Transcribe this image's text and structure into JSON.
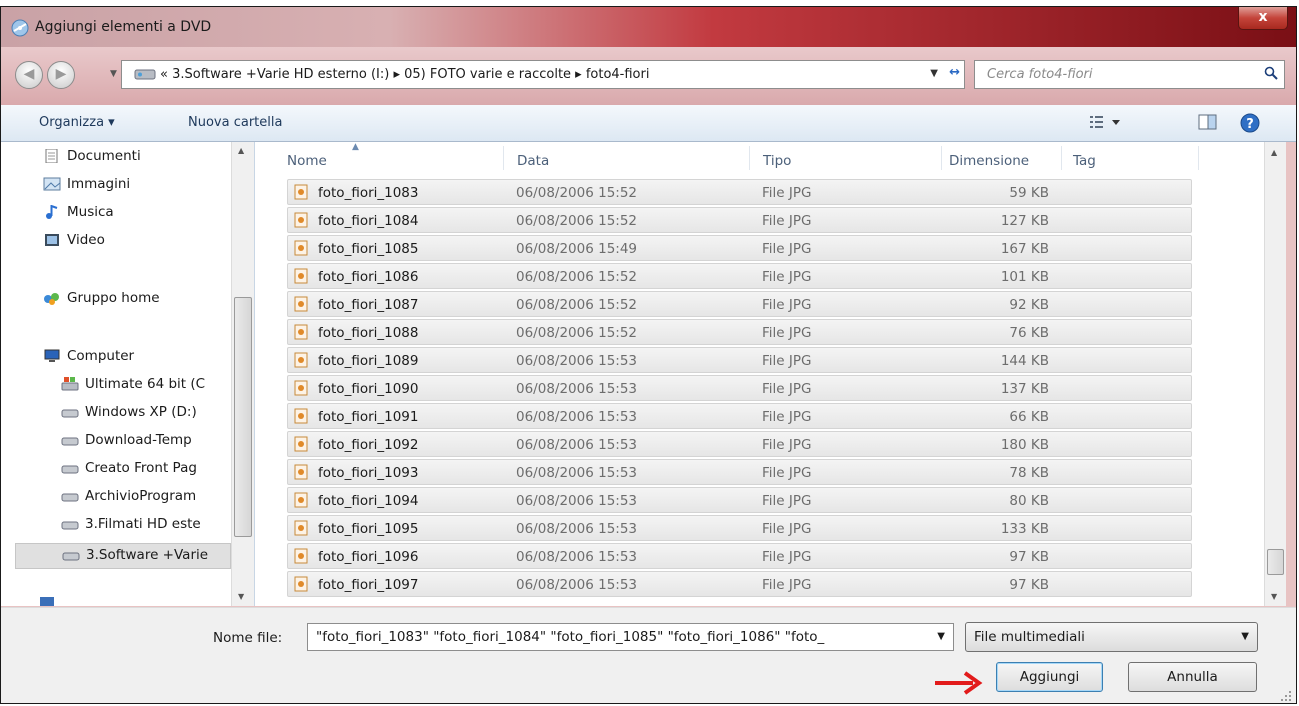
{
  "window": {
    "title": "Aggiungi elementi a DVD",
    "close_label": "x"
  },
  "address": {
    "breadcrumb": "« 3.Software +Varie HD esterno (I:) ▸ 05) FOTO varie e raccolte ▸ foto4-fiori",
    "search_placeholder": "Cerca foto4-fiori"
  },
  "toolbar": {
    "organize_label": "Organizza ▾",
    "new_folder_label": "Nuova cartella"
  },
  "nav": {
    "items": [
      {
        "label": "Documenti",
        "icon": "document-icon"
      },
      {
        "label": "Immagini",
        "icon": "pictures-icon"
      },
      {
        "label": "Musica",
        "icon": "music-icon"
      },
      {
        "label": "Video",
        "icon": "video-icon"
      },
      {
        "label": "Gruppo home",
        "icon": "homegroup-icon"
      },
      {
        "label": "Computer",
        "icon": "computer-icon"
      },
      {
        "label": "Ultimate 64 bit (C",
        "icon": "system-drive-icon"
      },
      {
        "label": "Windows XP (D:)",
        "icon": "drive-icon"
      },
      {
        "label": "Download-Temp",
        "icon": "drive-icon"
      },
      {
        "label": "Creato Front Pag",
        "icon": "drive-icon"
      },
      {
        "label": "ArchivioProgram",
        "icon": "drive-icon"
      },
      {
        "label": "3.Filmati HD este",
        "icon": "drive-icon"
      },
      {
        "label": "3.Software +Varie",
        "icon": "drive-icon"
      }
    ]
  },
  "columns": {
    "name": "Nome",
    "date": "Data",
    "type": "Tipo",
    "size": "Dimensione",
    "tag": "Tag"
  },
  "files": [
    {
      "name": "foto_fiori_1083",
      "date": "06/08/2006 15:52",
      "type": "File JPG",
      "size": "59 KB"
    },
    {
      "name": "foto_fiori_1084",
      "date": "06/08/2006 15:52",
      "type": "File JPG",
      "size": "127 KB"
    },
    {
      "name": "foto_fiori_1085",
      "date": "06/08/2006 15:49",
      "type": "File JPG",
      "size": "167 KB"
    },
    {
      "name": "foto_fiori_1086",
      "date": "06/08/2006 15:52",
      "type": "File JPG",
      "size": "101 KB"
    },
    {
      "name": "foto_fiori_1087",
      "date": "06/08/2006 15:52",
      "type": "File JPG",
      "size": "92 KB"
    },
    {
      "name": "foto_fiori_1088",
      "date": "06/08/2006 15:52",
      "type": "File JPG",
      "size": "76 KB"
    },
    {
      "name": "foto_fiori_1089",
      "date": "06/08/2006 15:53",
      "type": "File JPG",
      "size": "144 KB"
    },
    {
      "name": "foto_fiori_1090",
      "date": "06/08/2006 15:53",
      "type": "File JPG",
      "size": "137 KB"
    },
    {
      "name": "foto_fiori_1091",
      "date": "06/08/2006 15:53",
      "type": "File JPG",
      "size": "66 KB"
    },
    {
      "name": "foto_fiori_1092",
      "date": "06/08/2006 15:53",
      "type": "File JPG",
      "size": "180 KB"
    },
    {
      "name": "foto_fiori_1093",
      "date": "06/08/2006 15:53",
      "type": "File JPG",
      "size": "78 KB"
    },
    {
      "name": "foto_fiori_1094",
      "date": "06/08/2006 15:53",
      "type": "File JPG",
      "size": "80 KB"
    },
    {
      "name": "foto_fiori_1095",
      "date": "06/08/2006 15:53",
      "type": "File JPG",
      "size": "133 KB"
    },
    {
      "name": "foto_fiori_1096",
      "date": "06/08/2006 15:53",
      "type": "File JPG",
      "size": "97 KB"
    },
    {
      "name": "foto_fiori_1097",
      "date": "06/08/2006 15:53",
      "type": "File JPG",
      "size": "97 KB"
    }
  ],
  "footer": {
    "filename_label": "Nome file:",
    "filename_value": "\"foto_fiori_1083\" \"foto_fiori_1084\" \"foto_fiori_1085\" \"foto_fiori_1086\" \"foto_",
    "filter_value": "File multimediali",
    "add_label": "Aggiungi",
    "cancel_label": "Annulla"
  },
  "colors": {
    "title_accent": "#c23a40",
    "arrow": "#e21b1b",
    "toolbar_text": "#1e395b"
  }
}
